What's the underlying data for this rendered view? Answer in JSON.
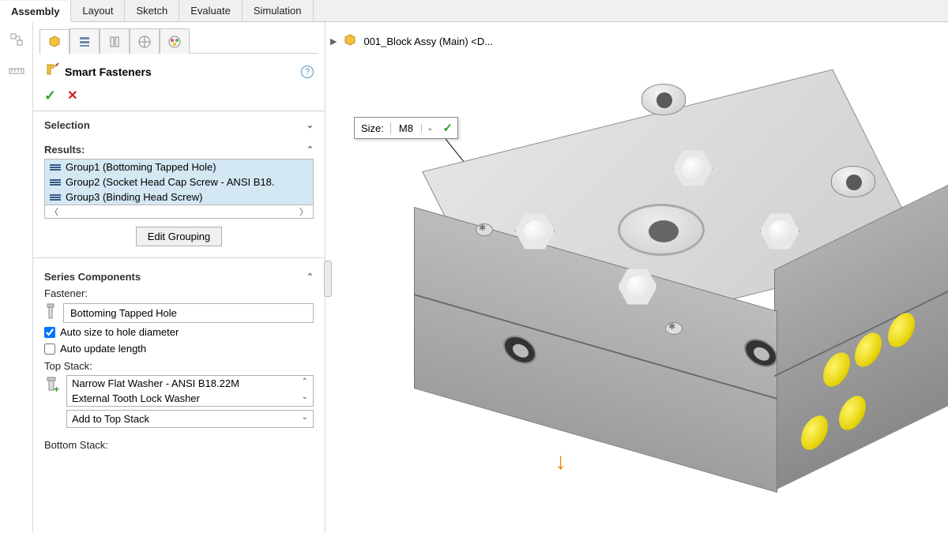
{
  "tabs": [
    "Assembly",
    "Layout",
    "Sketch",
    "Evaluate",
    "Simulation"
  ],
  "activeTab": 0,
  "breadcrumb": "001_Block Assy (Main) <D...",
  "panel": {
    "title": "Smart Fasteners",
    "selection_header": "Selection",
    "results_label": "Results:",
    "results": [
      "Group1 (Bottoming Tapped Hole)",
      "Group2 (Socket Head Cap Screw - ANSI B18.",
      "Group3 (Binding Head Screw)"
    ],
    "edit_grouping_btn": "Edit Grouping",
    "series_header": "Series Components",
    "fastener_label": "Fastener:",
    "fastener_value": "Bottoming Tapped Hole",
    "auto_size_label": "Auto size to hole diameter",
    "auto_update_label": "Auto update length",
    "top_stack_label": "Top Stack:",
    "top_stack_items": [
      "Narrow Flat Washer - ANSI B18.22M",
      "External Tooth Lock Washer"
    ],
    "add_top_stack": "Add to Top Stack",
    "bottom_stack_label": "Bottom Stack:"
  },
  "size_popup": {
    "label": "Size:",
    "value": "M8"
  }
}
